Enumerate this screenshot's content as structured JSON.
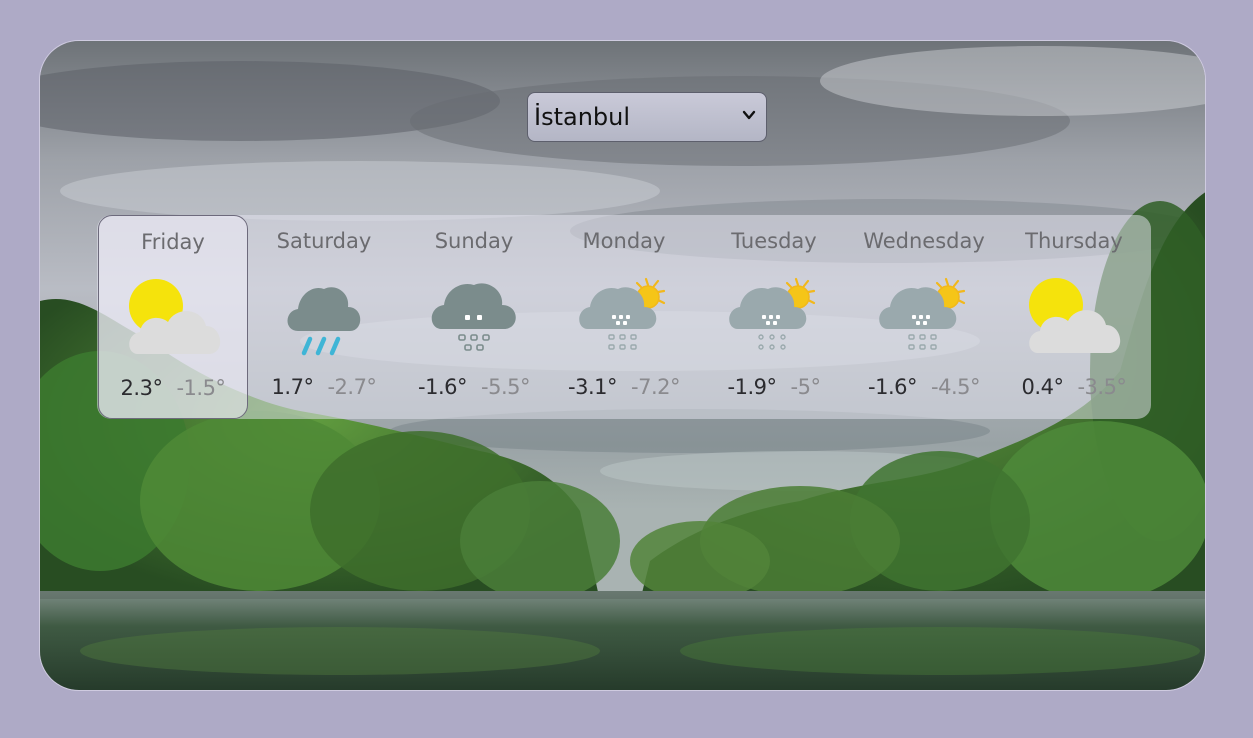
{
  "city_select": {
    "value": "İstanbul",
    "chevron_icon": "chevron-down-icon"
  },
  "selected_day_index": 0,
  "days": [
    {
      "name": "Friday",
      "high": "2.3°",
      "low": "-1.5°",
      "icon": "sun-behind-cloud-icon"
    },
    {
      "name": "Saturday",
      "high": "1.7°",
      "low": "-2.7°",
      "icon": "rain-cloud-icon"
    },
    {
      "name": "Sunday",
      "high": "-1.6°",
      "low": "-5.5°",
      "icon": "snow-cloud-icon"
    },
    {
      "name": "Monday",
      "high": "-3.1°",
      "low": "-7.2°",
      "icon": "snow-cloud-with-sun-icon"
    },
    {
      "name": "Tuesday",
      "high": "-1.9°",
      "low": "-5°",
      "icon": "snow-cloud-with-sun-icon"
    },
    {
      "name": "Wednesday",
      "high": "-1.6°",
      "low": "-4.5°",
      "icon": "snow-cloud-with-sun-icon"
    },
    {
      "name": "Thursday",
      "high": "0.4°",
      "low": "-3.5°",
      "icon": "sun-behind-cloud-icon"
    }
  ],
  "colors": {
    "page_background": "#aeaac6",
    "sun": "#f5e30c",
    "cloud_light": "#dcdcdc",
    "cloud_dark": "#7b8c8c",
    "cloud_snow": "#9aa9ad",
    "rain": "#3fb5d6",
    "text_high": "#2b2b2f",
    "text_low": "#8a8a8e"
  }
}
